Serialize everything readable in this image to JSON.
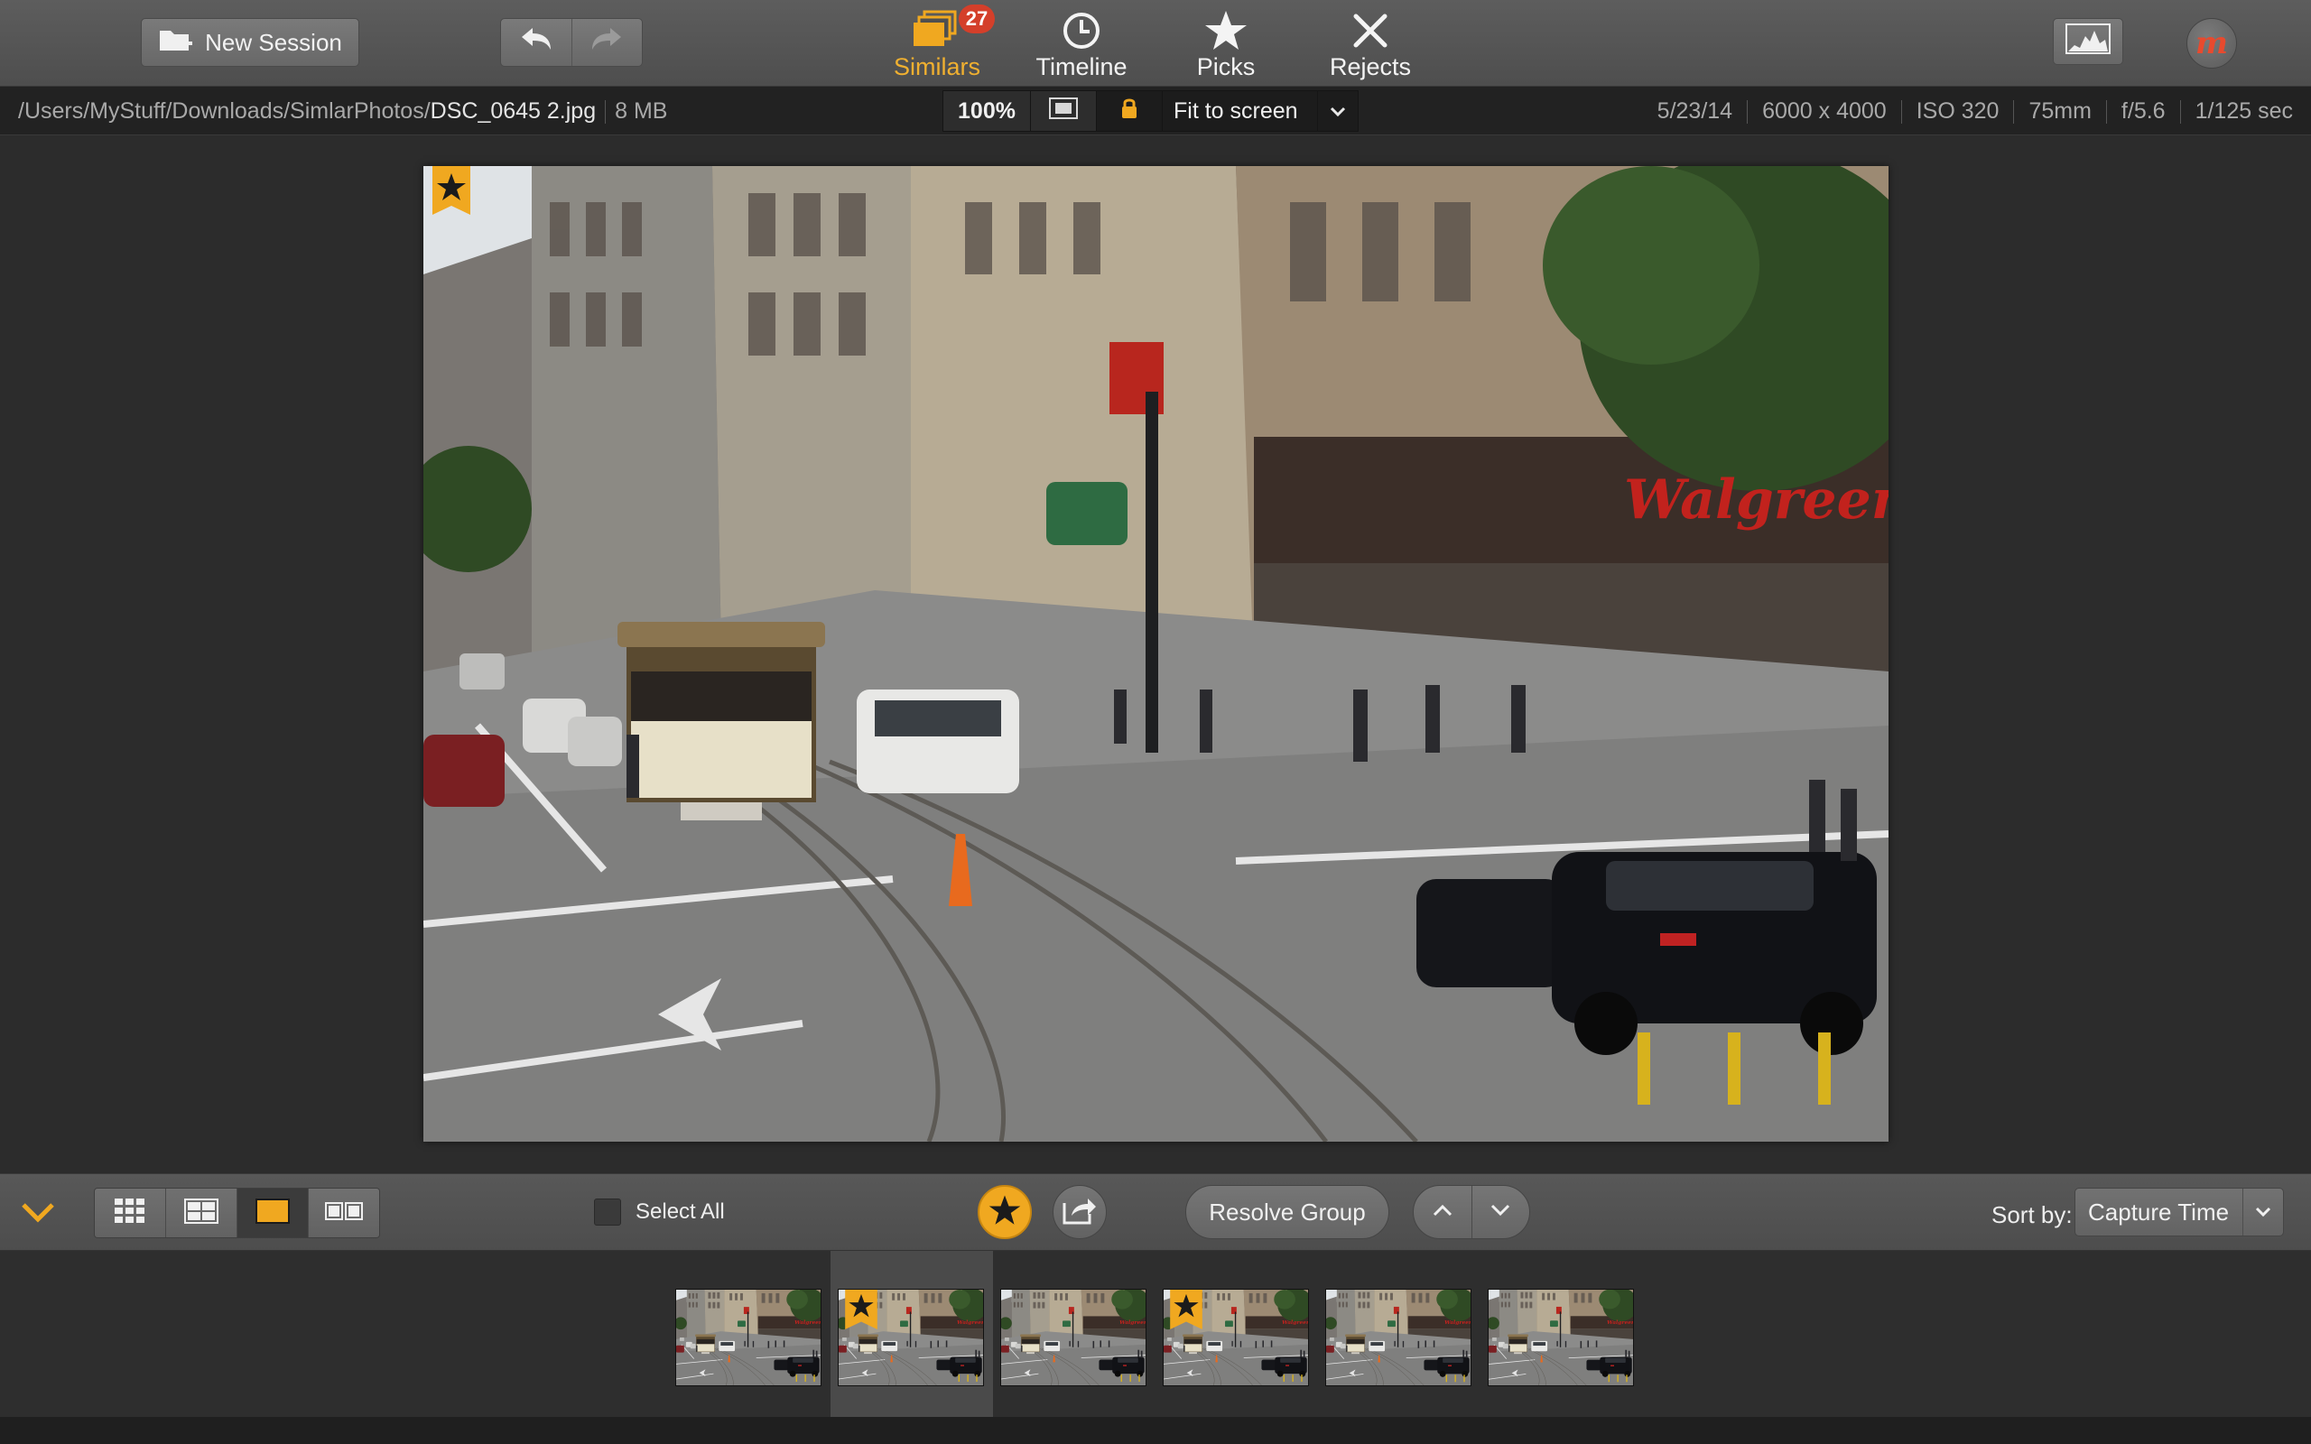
{
  "toolbar": {
    "new_session_label": "New Session",
    "modes": [
      {
        "label": "Similars",
        "badge": "27",
        "icon": "similars-stack-icon",
        "active": true
      },
      {
        "label": "Timeline",
        "icon": "clock-icon",
        "active": false
      },
      {
        "label": "Picks",
        "icon": "star-icon",
        "active": false
      },
      {
        "label": "Rejects",
        "icon": "x-icon",
        "active": false
      }
    ],
    "logo_text": "m"
  },
  "infobar": {
    "path_dir": "/Users/MyStuff/Downloads/SimlarPhotos/",
    "file_name": "DSC_0645 2.jpg",
    "file_size": "8 MB",
    "zoom": "100%",
    "zoom_mode": "Fit to screen",
    "meta": [
      "5/23/14",
      "6000 x 4000",
      "ISO 320",
      "75mm",
      "f/5.6",
      "1/125 sec"
    ]
  },
  "bottombar": {
    "select_all_label": "Select All",
    "resolve_label": "Resolve Group",
    "sort_label": "Sort by:",
    "sort_value": "Capture Time"
  },
  "filmstrip": {
    "selected_index": 1,
    "thumbs": [
      {
        "picked": false
      },
      {
        "picked": true
      },
      {
        "picked": false
      },
      {
        "picked": true
      },
      {
        "picked": false
      },
      {
        "picked": false
      }
    ]
  },
  "colors": {
    "accent": "#f0a820",
    "badge": "#d43f2a"
  }
}
